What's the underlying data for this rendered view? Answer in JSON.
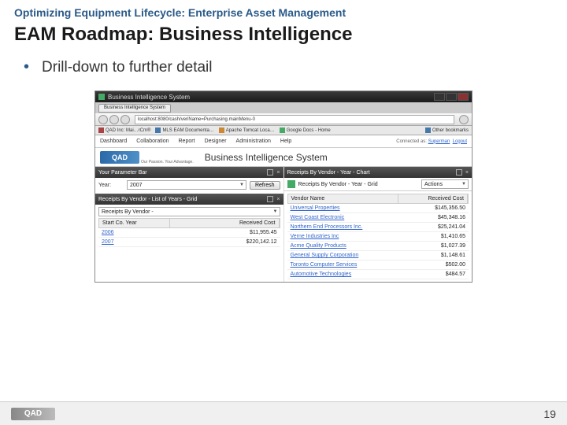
{
  "slide": {
    "header": "Optimizing Equipment Lifecycle: Enterprise Asset Management",
    "title": "EAM Roadmap: Business Intelligence",
    "bullet": "Drill-down to further detail",
    "page_number": "19",
    "footer_logo": "QAD"
  },
  "browser": {
    "window_title": "Business Intelligence System",
    "url": "localhost:8080/cash/veriName=Purchasing.mainMenu-0",
    "bookmarks": [
      "QAD Inc: Mai…rCm®",
      "MLS EAM Documenta…",
      "Apache Tomcat Loca…",
      "Google Docs - Home"
    ],
    "bookmarks_right": "Other bookmarks"
  },
  "app": {
    "menu": [
      "Dashboard",
      "Collaboration",
      "Report",
      "Designer",
      "Administration",
      "Help"
    ],
    "connected_as": "Connected as:",
    "user": "Superman",
    "logout": "Logout",
    "logo_text": "QAD",
    "tagline": "Our Passion. Your Advantage.",
    "system_title": "Business Intelligence System"
  },
  "param_bar": {
    "title": "Your Parameter Bar",
    "year_label": "Year:",
    "year_value": "2007",
    "refresh": "Refresh"
  },
  "left_list": {
    "title": "Receipts By Vendor - List of Years - Grid",
    "grid_label": "Receipts By Vendor -",
    "col1": "Start Co. Year",
    "col2": "Received Cost",
    "rows": [
      {
        "year": "2006",
        "cost": "$11,955.45"
      },
      {
        "year": "2007",
        "cost": "$220,142.12"
      }
    ]
  },
  "right_chart": {
    "title": "Receipts By Vendor - Year - Chart"
  },
  "right_grid": {
    "label": "Receipts By Vendor - Year - Grid",
    "actions": "Actions",
    "col1": "Vendor Name",
    "col2": "Received Cost",
    "rows": [
      {
        "name": "Universal Properties",
        "cost": "$145,356.50"
      },
      {
        "name": "West Coast Electronic",
        "cost": "$45,348.16"
      },
      {
        "name": "Northern End Processors Inc.",
        "cost": "$25,241.04"
      },
      {
        "name": "Verne Industries Inc",
        "cost": "$1,410.65"
      },
      {
        "name": "Acme Quality Products",
        "cost": "$1,027.39"
      },
      {
        "name": "General Supply Corporation",
        "cost": "$1,148.61"
      },
      {
        "name": "Toronto Computer Services",
        "cost": "$502.00"
      },
      {
        "name": "Automotive Technologies",
        "cost": "$484.57"
      }
    ]
  }
}
